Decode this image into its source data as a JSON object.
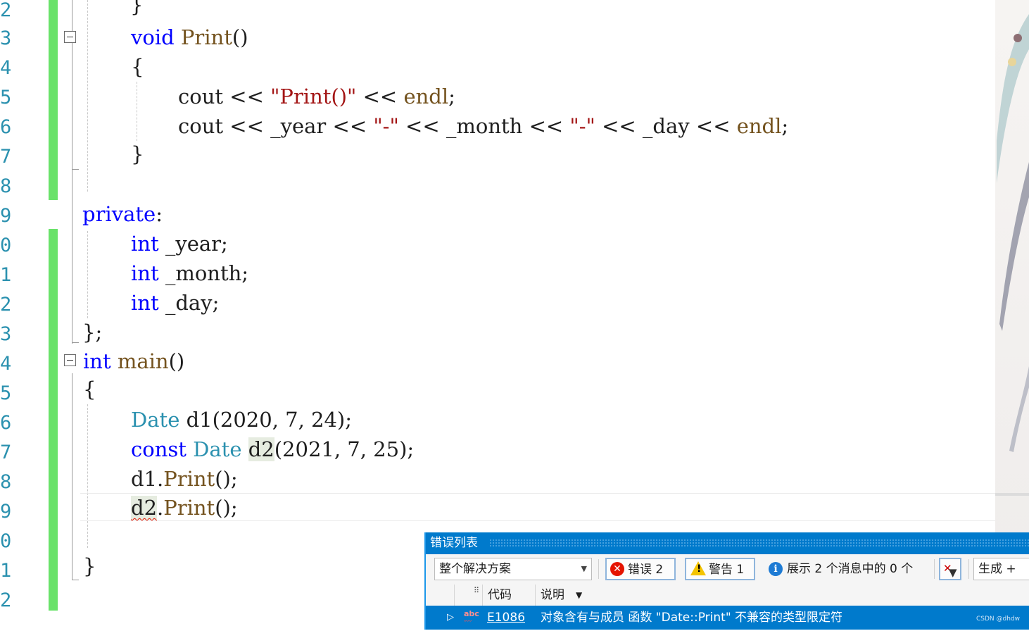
{
  "editor": {
    "line_numbers": [
      "2",
      "3",
      "4",
      "5",
      "6",
      "7",
      "8",
      "9",
      "0",
      "1",
      "2",
      "3",
      "4",
      "5",
      "6",
      "7",
      "8",
      "9",
      "0",
      "1",
      "2"
    ],
    "tokens": {
      "brace_close": "}",
      "brace_open": "{",
      "void": "void",
      "print": "Print",
      "parens": "()",
      "cout": "cout",
      "shl": "<<",
      "print_str": "\"Print()\"",
      "endl": "endl",
      "semi": ";",
      "year": "_year",
      "month": "_month",
      "day": "_day",
      "dash_str": "\"-\"",
      "private": "private",
      "colon": ":",
      "int": "int",
      "year_decl": "_year;",
      "month_decl": "_month;",
      "day_decl": "_day;",
      "class_end": "};",
      "main": "main",
      "date": "Date",
      "d1": "d1",
      "d1_args": "(2020, 7, 24);",
      "const": "const",
      "d2": "d2",
      "d2_args": "(2021, 7, 25);",
      "call_tail": "();",
      "dot": "."
    }
  },
  "error_list": {
    "title": "错误列表",
    "scope": "整个解决方案",
    "errors_label": "错误 2",
    "warnings_label": "警告 1",
    "messages_label": "展示 2 个消息中的 0 个",
    "build_label": "生成 + In",
    "col_code": "代码",
    "col_desc": "说明",
    "row": {
      "code": "E1086",
      "description": "对象含有与成员 函数 \"Date::Print\" 不兼容的类型限定符"
    },
    "watermark": "CSDN @dhdw"
  },
  "colors": {
    "keyword": "#0000ff",
    "type": "#2b91af",
    "function": "#74531f",
    "string": "#a31515",
    "change_bar": "#6ae26a",
    "accent": "#007acc"
  }
}
